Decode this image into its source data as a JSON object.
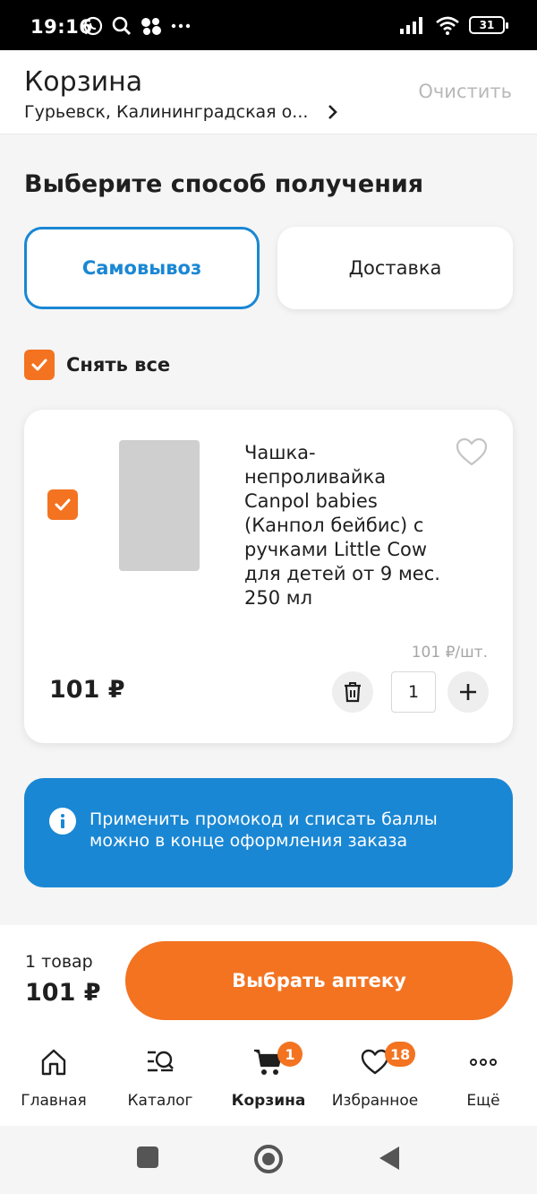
{
  "status_bar": {
    "time": "19:16",
    "battery": "31"
  },
  "header": {
    "title": "Корзина",
    "location": "Гурьевск, Калининградская о...",
    "clear_label": "Очистить"
  },
  "delivery": {
    "heading": "Выберите способ получения",
    "options": [
      {
        "label": "Самовывоз",
        "selected": true
      },
      {
        "label": "Доставка",
        "selected": false
      }
    ]
  },
  "select_all_label": "Снять все",
  "cart_item": {
    "name": "Чашка-непроливайка Canpol babies (Канпол бейбис) с ручками Little Cow для детей от 9 мес. 250 мл",
    "unit_price": "101 ₽/шт.",
    "total": "101 ₽",
    "quantity": "1",
    "checked": true
  },
  "info_banner": {
    "text": "Применить промокод и списать баллы можно в конце оформления заказа"
  },
  "summary": {
    "count": "1 товар",
    "total": "101 ₽",
    "cta_label": "Выбрать аптеку"
  },
  "tabbar": [
    {
      "label": "Главная",
      "icon": "home-icon"
    },
    {
      "label": "Каталог",
      "icon": "catalog-search-icon"
    },
    {
      "label": "Корзина",
      "icon": "cart-icon",
      "badge": "1",
      "active": true
    },
    {
      "label": "Избранное",
      "icon": "heart-icon",
      "badge": "18"
    },
    {
      "label": "Ещё",
      "icon": "more-icon"
    }
  ],
  "colors": {
    "accent_orange": "#f37321",
    "accent_blue": "#1a87d4"
  }
}
